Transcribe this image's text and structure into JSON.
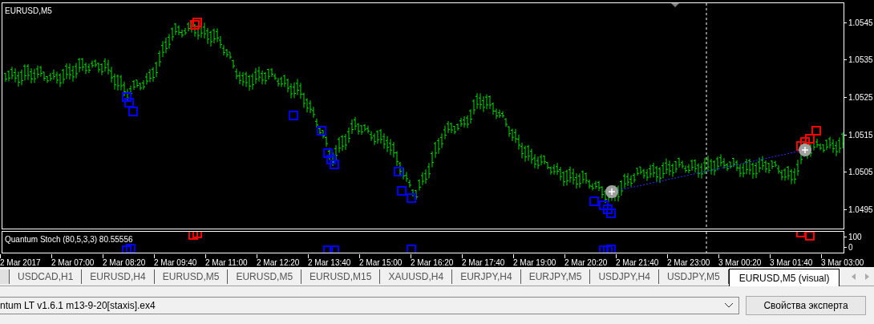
{
  "chart": {
    "symbol_label": "EURUSD,M5",
    "price_ticks": [
      "1.0545",
      "1.0535",
      "1.0525",
      "1.0515",
      "1.0505",
      "1.0495"
    ],
    "indicator": {
      "label": "Quantum Stoch (80,5,3,3) 80.55556",
      "ticks": [
        "100",
        "0"
      ]
    },
    "time_labels": [
      "2 Mar 2017",
      "2 Mar 07:00",
      "2 Mar 08:20",
      "2 Mar 09:40",
      "2 Mar 11:00",
      "2 Mar 12:20",
      "2 Mar 13:40",
      "2 Mar 15:00",
      "2 Mar 16:20",
      "2 Mar 17:40",
      "2 Mar 19:00",
      "2 Mar 20:20",
      "2 Mar 21:40",
      "2 Mar 23:00",
      "3 Mar 00:20",
      "3 Mar 01:40",
      "3 Mar 03:00"
    ]
  },
  "tabs": [
    {
      "label": "USDCAD,H1",
      "selected": false
    },
    {
      "label": "EURUSD,H4",
      "selected": false
    },
    {
      "label": "EURUSD,M5",
      "selected": false
    },
    {
      "label": "EURUSD,M5",
      "selected": false
    },
    {
      "label": "EURUSD,M15",
      "selected": false
    },
    {
      "label": "XAUUSD,H4",
      "selected": false
    },
    {
      "label": "EURJPY,H4",
      "selected": false
    },
    {
      "label": "EURJPY,M5",
      "selected": false
    },
    {
      "label": "USDJPY,H4",
      "selected": false
    },
    {
      "label": "USDJPY,M5",
      "selected": false
    },
    {
      "label": "EURUSD,M5 (visual)",
      "selected": true
    }
  ],
  "expert": {
    "value": "ntum LT v1.6.1 m13-9-20[staxis].ex4"
  },
  "properties_button": "Свойства эксперта"
}
